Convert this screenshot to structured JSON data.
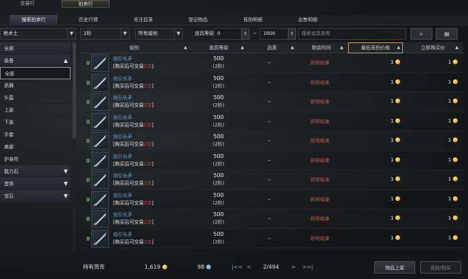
{
  "top_tabs": [
    "交易行",
    "拍卖行"
  ],
  "sub_tabs": [
    "搜索拍卖行",
    "历史行情",
    "关注目录",
    "登记物品",
    "竞拍明细",
    "出售明细"
  ],
  "filters": {
    "class_value": "枪术士",
    "tier_value": "2阶",
    "grade_value": "所有级别",
    "item_level_label": "道具等级",
    "level_min": "0",
    "level_sep": "~",
    "level_max": "1600",
    "search_placeholder": "搜索道具名称",
    "search_icon": "magnifier-icon",
    "filter_icon": "filter-settings-icon"
  },
  "sidebar": {
    "items": [
      {
        "label": "全部",
        "type": "header"
      },
      {
        "label": "装备",
        "type": "header",
        "chevron": "▲"
      },
      {
        "label": "全部",
        "type": "sub-selected"
      },
      {
        "label": "武器",
        "type": "sub"
      },
      {
        "label": "头盔",
        "type": "sub"
      },
      {
        "label": "上装",
        "type": "sub"
      },
      {
        "label": "下装",
        "type": "sub"
      },
      {
        "label": "手套",
        "type": "sub"
      },
      {
        "label": "肩部",
        "type": "sub"
      },
      {
        "label": "护身符",
        "type": "sub"
      },
      {
        "label": "能力石",
        "type": "header",
        "chevron": "▼"
      },
      {
        "label": "首饰",
        "type": "header",
        "chevron": "▼"
      },
      {
        "label": "宝石",
        "type": "header",
        "chevron": "▼"
      }
    ]
  },
  "table": {
    "headers": {
      "level": "级别",
      "item_level": "道具等级",
      "grade": "品质",
      "remaining": "剩余时间",
      "min_bid": "最低竞拍价格",
      "buyout": "立即购买价"
    },
    "sort_symbol": "▲",
    "rows": [
      {
        "name": "焰引长矛",
        "note_prefix": "[购买后可交易",
        "note_count": "2次",
        "note_suffix": "]",
        "item_level": "500",
        "tier": "(2阶)",
        "grade": "–",
        "remaining": "即将结束",
        "min_bid": "1",
        "buyout": "1"
      },
      {
        "name": "焰引长矛",
        "note_prefix": "[购买后可交易",
        "note_count": "2次",
        "note_suffix": "]",
        "item_level": "500",
        "tier": "(2阶)",
        "grade": "–",
        "remaining": "即将结束",
        "min_bid": "1",
        "buyout": "1"
      },
      {
        "name": "焰引长矛",
        "note_prefix": "[购买后可交易",
        "note_count": "2次",
        "note_suffix": "]",
        "item_level": "500",
        "tier": "(2阶)",
        "grade": "–",
        "remaining": "即将结束",
        "min_bid": "1",
        "buyout": "1"
      },
      {
        "name": "焰引长矛",
        "note_prefix": "[购买后可交易",
        "note_count": "2次",
        "note_suffix": "]",
        "item_level": "500",
        "tier": "(2阶)",
        "grade": "–",
        "remaining": "即将结束",
        "min_bid": "1",
        "buyout": "1"
      },
      {
        "name": "焰引长矛",
        "note_prefix": "[购买后可交易",
        "note_count": "2次",
        "note_suffix": "]",
        "item_level": "500",
        "tier": "(2阶)",
        "grade": "–",
        "remaining": "即将结束",
        "min_bid": "1",
        "buyout": "1"
      },
      {
        "name": "焰引长矛",
        "note_prefix": "[购买后可交易",
        "note_count": "2次",
        "note_suffix": "]",
        "item_level": "500",
        "tier": "(2阶)",
        "grade": "–",
        "remaining": "即将结束",
        "min_bid": "1",
        "buyout": "1"
      },
      {
        "name": "焰引长矛",
        "note_prefix": "[购买后可交易",
        "note_count": "2次",
        "note_suffix": "]",
        "item_level": "500",
        "tier": "(2阶)",
        "grade": "–",
        "remaining": "即将结束",
        "min_bid": "1",
        "buyout": "1"
      },
      {
        "name": "焰引长矛",
        "note_prefix": "[购买后可交易",
        "note_count": "2次",
        "note_suffix": "]",
        "item_level": "500",
        "tier": "(2阶)",
        "grade": "–",
        "remaining": "即将结束",
        "min_bid": "1",
        "buyout": "1"
      },
      {
        "name": "焰引长矛",
        "note_prefix": "[购买后可交易",
        "note_count": "2次",
        "note_suffix": "]",
        "item_level": "500",
        "tier": "(2阶)",
        "grade": "–",
        "remaining": "即将结束",
        "min_bid": "1",
        "buyout": "1"
      },
      {
        "name": "焰引长矛",
        "note_prefix": "[购买后可交易",
        "note_count": "2次",
        "note_suffix": "]",
        "item_level": "500",
        "tier": "(2阶)",
        "grade": "–",
        "remaining": "即将结束",
        "min_bid": "1",
        "buyout": "1"
      }
    ]
  },
  "footer": {
    "currency_label": "持有货币",
    "gold": "1,619",
    "blue_crystal": "98",
    "pager_first": "K",
    "pager_prev": "<",
    "page": "2/494",
    "pager_next": ">",
    "pager_last": "K",
    "register_button": "物品上架",
    "bid_button": "竞拍/购买"
  },
  "colors": {
    "accent_gold": "#c7a64a",
    "name_blue": "#5ea6e6",
    "remaining_red": "#d1564a",
    "note_red": "#e0493a"
  }
}
